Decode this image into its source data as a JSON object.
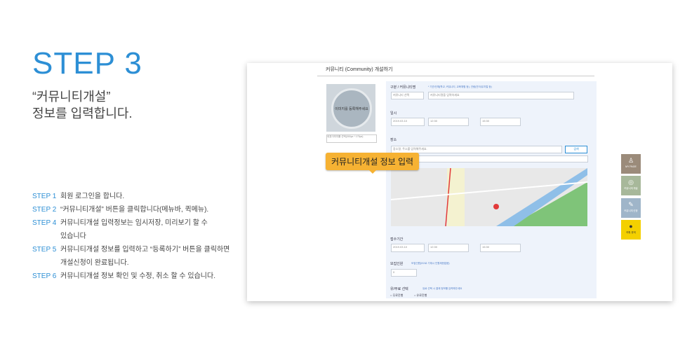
{
  "title": "STEP 3",
  "subtitle_line1": "“커뮤니티개설”",
  "subtitle_line2": "정보를 입력합니다.",
  "steps": [
    {
      "label": "STEP 1",
      "text": "회원 로그인을 합니다."
    },
    {
      "label": "STEP 2",
      "text": "“커뮤니티개설” 버튼을 클릭합니다(메뉴바, 퀵메뉴)."
    },
    {
      "label": "STEP 4",
      "text": "커뮤니티개설 입력정보는 임시저장, 미리보기 할 수",
      "text2": "있습니다"
    },
    {
      "label": "STEP 5",
      "text": "커뮤니티개설 정보를 입력하고 “등록하기” 버튼을 클릭하면",
      "text2": "개설신청이 완료됩니다."
    },
    {
      "label": "STEP 6",
      "text": "커뮤니티개설 정보 확인 및 수정, 취소 할 수 있습니다."
    }
  ],
  "screenshot": {
    "header": "커뮤니티 (Community) 개설하기",
    "thumb_text": "이미지를 등록해주세요",
    "thumb_select": "대표이미지를 선택(300px * 175px)",
    "fields": {
      "category_label": "구분 / 커뮤니티명",
      "category_note": "* 기관/단체(학교, 커뮤니티, 교육체험 등), 관람(연극/뮤지컬 등)",
      "category_value": "커뮤니티 선택",
      "name_placeholder": "커뮤니티명을 입력하세요",
      "date_label": "일시",
      "date_value": "2019.03.10",
      "time_value": "12:30",
      "time_value2": "15:30",
      "place_label": "장소",
      "place_placeholder": "장소명, 주소를 입력해주세요.",
      "place_button": "검색",
      "apply_label": "접수기간",
      "apply_date": "2019.03.10",
      "apply_time": "12:30",
      "apply_time2": "15:30",
      "recruit_label": "모집인원",
      "recruit_note": "모집인원(0으로 기재시 인원제한없음)",
      "recruit_value": "0",
      "fee_label": "유/무료 선택",
      "fee_note": "유료 선택 시 결제 정보를 입력해주세요",
      "fee_free": "무료진행",
      "fee_paid": "유료진행"
    },
    "callout": "커뮤니티개설 정보 입력"
  },
  "quick_menu": [
    {
      "label": "MY PAGE",
      "icon": "user-icon",
      "color": "#9b8b7a"
    },
    {
      "label": "커뮤니티개설",
      "icon": "community-icon",
      "color": "#a7b89a"
    },
    {
      "label": "커뮤니티신청",
      "icon": "edit-icon",
      "color": "#9fb5c9"
    },
    {
      "label": "카톡 문의",
      "icon": "talk-icon",
      "color": "#f4d000"
    }
  ]
}
